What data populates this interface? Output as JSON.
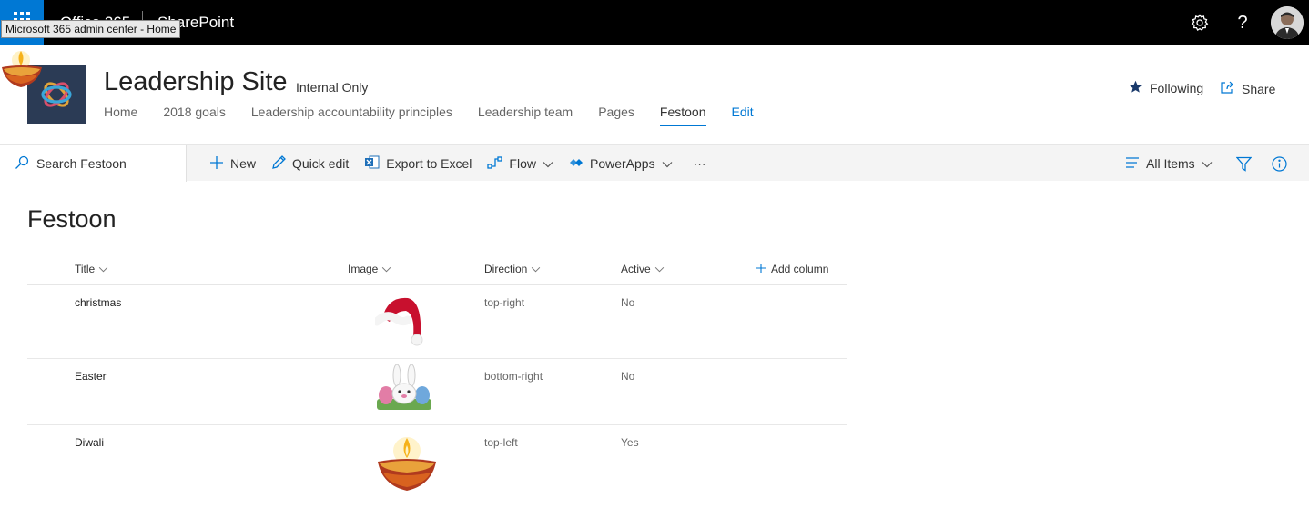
{
  "suite": {
    "brand": "Office 365",
    "app": "SharePoint",
    "tooltip": "Microsoft 365 admin center - Home",
    "icons": [
      "waffle-icon",
      "gear-icon",
      "help-icon",
      "avatar"
    ]
  },
  "site": {
    "title": "Leadership Site",
    "classification": "Internal Only",
    "nav": [
      {
        "label": "Home",
        "selected": false
      },
      {
        "label": "2018 goals",
        "selected": false
      },
      {
        "label": "Leadership accountability principles",
        "selected": false
      },
      {
        "label": "Leadership team",
        "selected": false
      },
      {
        "label": "Pages",
        "selected": false
      },
      {
        "label": "Festoon",
        "selected": true
      }
    ],
    "edit_label": "Edit",
    "following_label": "Following",
    "share_label": "Share"
  },
  "commandbar": {
    "search_placeholder": "Search Festoon",
    "new_label": "New",
    "quick_edit_label": "Quick edit",
    "export_label": "Export to Excel",
    "flow_label": "Flow",
    "powerapps_label": "PowerApps",
    "more_label": "···",
    "view_label": "All Items"
  },
  "list": {
    "title": "Festoon",
    "columns": [
      "Title",
      "Image",
      "Direction",
      "Active"
    ],
    "add_column_label": "Add column",
    "rows": [
      {
        "title": "christmas",
        "image": "santa-hat-image",
        "direction": "top-right",
        "active": "No"
      },
      {
        "title": "Easter",
        "image": "easter-bunny-image",
        "direction": "bottom-right",
        "active": "No"
      },
      {
        "title": "Diwali",
        "image": "diya-lamp-image",
        "direction": "top-left",
        "active": "Yes"
      }
    ]
  },
  "colors": {
    "suite_bar": "#000000",
    "accent": "#0078d4",
    "command_bar": "#f4f4f4",
    "site_logo_bg": "#2b3b55"
  }
}
